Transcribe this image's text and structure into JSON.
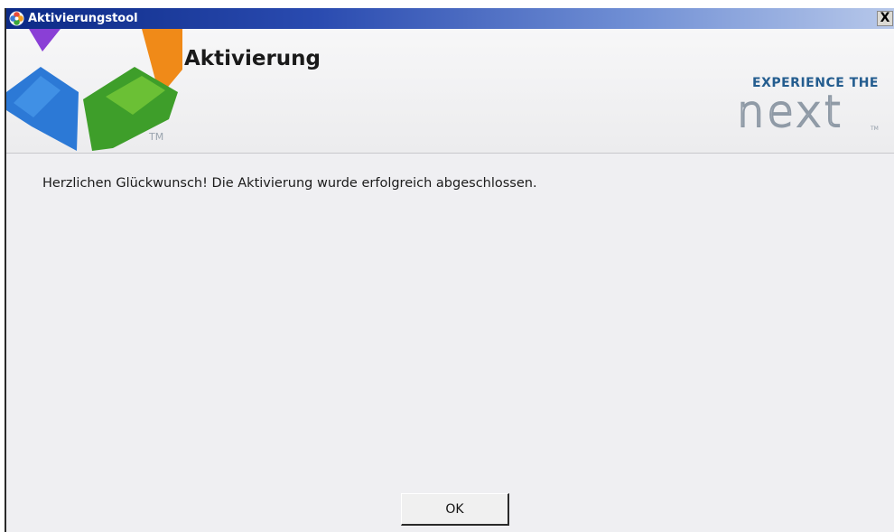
{
  "window": {
    "title": "Aktivierungstool",
    "close_label": "X"
  },
  "header": {
    "title": "Aktivierung",
    "logo_icon": "colorful-petal-logo",
    "logo_trademark": "TM",
    "brand_tagline": "EXPERIENCE THE",
    "brand_word": "next",
    "brand_trademark": "TM"
  },
  "message": {
    "text": "Herzlichen Glückwunsch! Die Aktivierung wurde erfolgreich abgeschlossen."
  },
  "buttons": {
    "ok_label": "OK"
  },
  "colors": {
    "titlebar_start": "#0c2a86",
    "titlebar_end": "#b7c8ea",
    "brand_text": "#245d8f",
    "background": "#efeff2"
  }
}
